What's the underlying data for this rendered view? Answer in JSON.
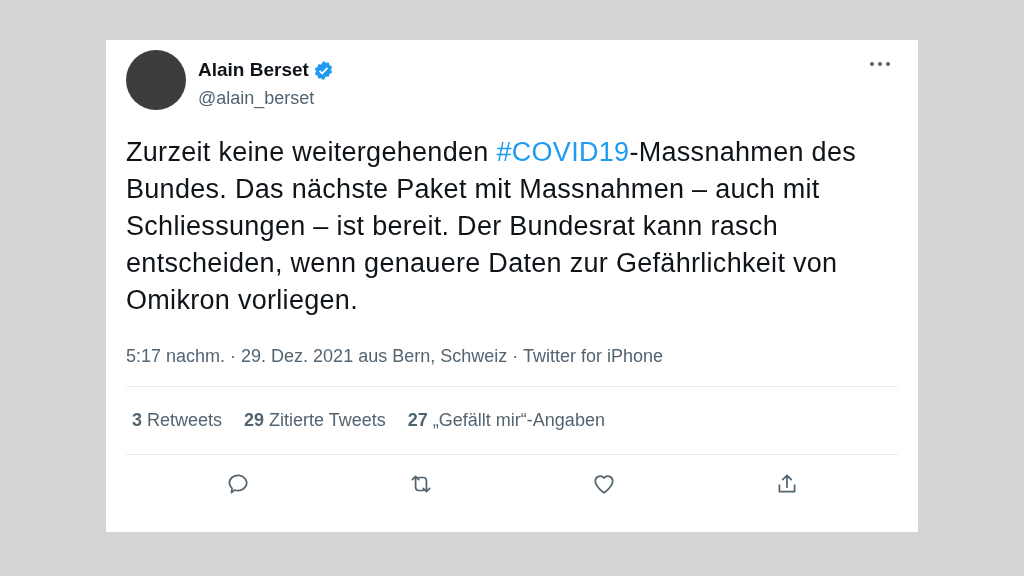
{
  "tweet": {
    "author": {
      "name": "Alain Berset",
      "verified": true,
      "handle": "@alain_berset"
    },
    "body": [
      {
        "kind": "text",
        "text": "Zurzeit keine weitergehenden "
      },
      {
        "kind": "hashtag",
        "text": "#COVID19"
      },
      {
        "kind": "text",
        "text": "-Massnahmen des Bundes. Das nächste Paket mit Massnahmen – auch mit Schliessungen – ist bereit. Der Bundesrat kann rasch entscheiden, wenn genauere Daten zur Gefährlichkeit von Omikron vorliegen."
      }
    ],
    "meta": "5:17 nachm. · 29. Dez. 2021 aus Bern, Schweiz · Twitter for iPhone",
    "stats": [
      "**3** Retweets",
      "**29** Zitierte Tweets",
      "**27** „Gefällt mir“-Angaben"
    ],
    "actions": [
      {
        "kind": "reply"
      },
      {
        "kind": "retweet"
      },
      {
        "kind": "like"
      },
      {
        "kind": "share"
      }
    ]
  }
}
